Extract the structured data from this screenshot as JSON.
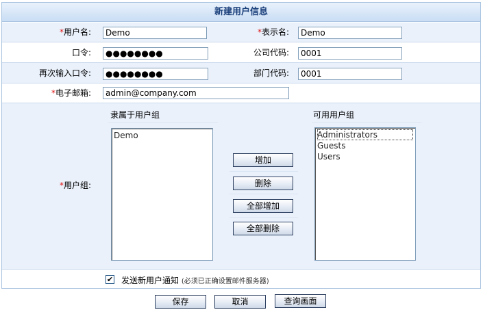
{
  "form": {
    "title": "新建用户信息",
    "required_mark": "*",
    "fields": {
      "username": {
        "label": "用户名:",
        "value": "Demo"
      },
      "displayname": {
        "label": "表示名:",
        "value": "Demo"
      },
      "password": {
        "label": "口令:",
        "value": "●●●●●●●●"
      },
      "company_code": {
        "label": "公司代码:",
        "value": "0001"
      },
      "password_confirm": {
        "label": "再次输入口令:",
        "value": "●●●●●●●●"
      },
      "dept_code": {
        "label": "部门代码:",
        "value": "0001"
      },
      "email": {
        "label": "电子邮箱:",
        "value": "admin@company.com"
      }
    },
    "groups": {
      "label": "用户组:",
      "member_header": "隶属于用户组",
      "available_header": "可用用户组",
      "member_items": [
        "Demo"
      ],
      "available_items": [
        "Administrators",
        "Guests",
        "Users"
      ],
      "selected_available": "Administrators",
      "buttons": {
        "add": "增加",
        "remove": "删除",
        "add_all": "全部增加",
        "remove_all": "全部删除"
      }
    },
    "notify": {
      "checked": true,
      "check_glyph": "✔",
      "label": "发送新用户通知",
      "note": "(必须已正确设置邮件服务器)"
    }
  },
  "actions": {
    "save": "保存",
    "cancel": "取消",
    "query": "查询画面"
  }
}
